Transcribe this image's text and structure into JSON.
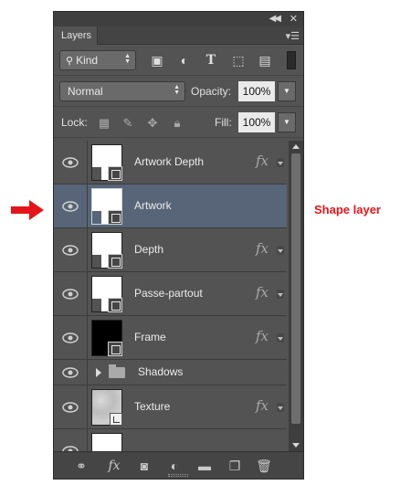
{
  "panel": {
    "tab_label": "Layers",
    "filter": {
      "kind_label": "Kind"
    },
    "blend_mode": "Normal",
    "opacity_label": "Opacity:",
    "opacity_value": "100%",
    "lock_label": "Lock:",
    "fill_label": "Fill:",
    "fill_value": "100%"
  },
  "layers": [
    {
      "name": "Artwork Depth",
      "thumb": "white-shape",
      "badge": "shape",
      "fx": "fx",
      "selected": false
    },
    {
      "name": "Artwork",
      "thumb": "white-shape",
      "badge": "shape",
      "fx": "",
      "selected": true
    },
    {
      "name": "Depth",
      "thumb": "white-shape",
      "badge": "shape",
      "fx": "fx",
      "selected": false
    },
    {
      "name": "Passe-partout",
      "thumb": "white-shape",
      "badge": "shape",
      "fx": "fx",
      "selected": false
    },
    {
      "name": "Frame",
      "thumb": "black-shape",
      "badge": "shape",
      "fx": "fx",
      "selected": false
    },
    {
      "name": "Shadows",
      "type": "group"
    },
    {
      "name": "Texture",
      "thumb": "texture",
      "badge": "smart-object",
      "fx": "fx",
      "selected": false
    }
  ],
  "annotation": {
    "text": "Shape layer",
    "color": "#e4141a",
    "arrow_color": "#e4141a"
  },
  "colors": {
    "panel_bg": "#535353",
    "selected_row": "#586578",
    "dark_bar": "#3f3f3f"
  },
  "icons": {
    "filter": [
      "pixel-filter-icon",
      "adjustment-filter-icon",
      "type-filter-icon",
      "shape-filter-icon",
      "smart-object-filter-icon"
    ],
    "lock": [
      "lock-transparent-icon",
      "lock-image-icon",
      "lock-position-icon",
      "lock-all-icon"
    ],
    "bottom": [
      "link-layers-icon",
      "layer-style-icon",
      "add-mask-icon",
      "adjustment-layer-icon",
      "new-group-icon",
      "new-layer-icon",
      "delete-layer-icon"
    ]
  }
}
